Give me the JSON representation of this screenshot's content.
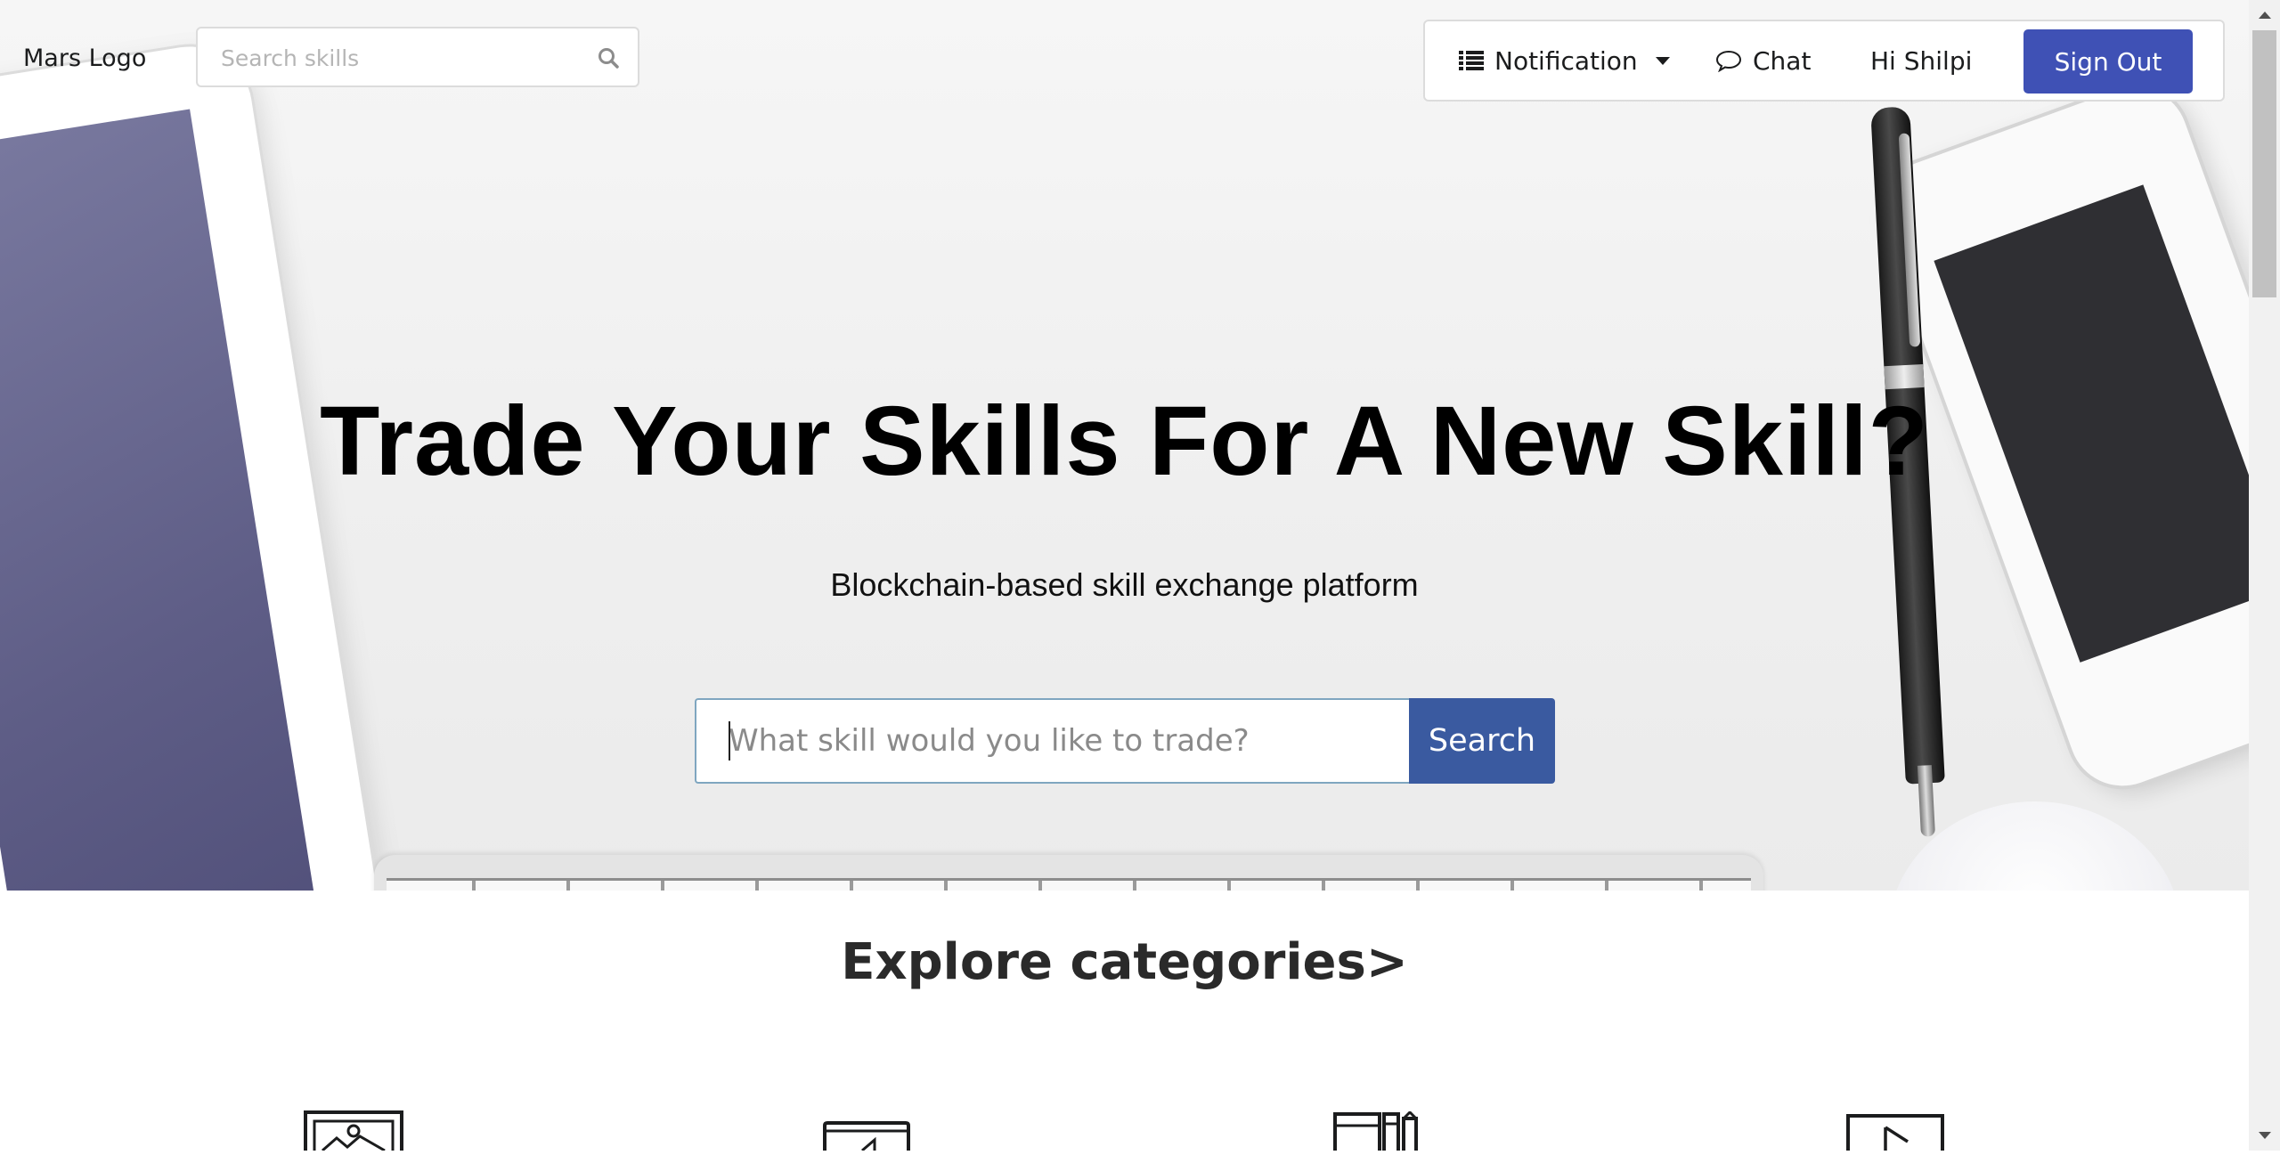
{
  "navbar": {
    "logo_text": "Mars Logo",
    "search_placeholder": "Search skills",
    "search_icon": "search-icon",
    "notification_label": "Notification",
    "notification_icon": "list-icon",
    "chat_label": "Chat",
    "chat_icon": "chat-bubble-icon",
    "greeting": "Hi Shilpi",
    "signout_label": "Sign Out"
  },
  "hero": {
    "headline": "Trade Your Skills For A New Skill?",
    "subheadline": "Blockchain-based skill exchange platform",
    "search_placeholder": "What skill would you like to trade?",
    "search_button": "Search"
  },
  "categories": {
    "title": "Explore categories>",
    "icons": [
      "image-frame-icon",
      "presentation-icon",
      "books-icon",
      "video-play-icon"
    ]
  },
  "colors": {
    "signout_bg": "#3f51b5",
    "search_button_bg": "#3a5aa0",
    "input_border": "#7fa6c0"
  }
}
